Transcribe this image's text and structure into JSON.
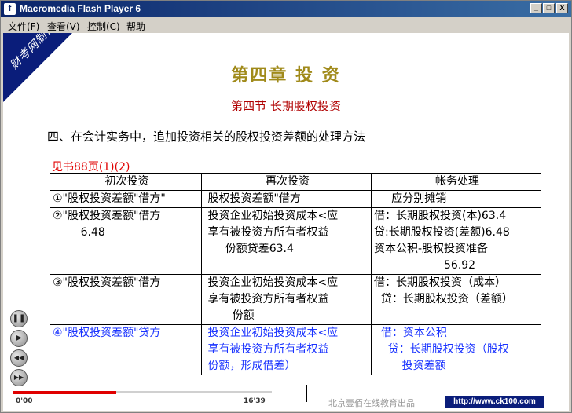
{
  "window": {
    "title": "Macromedia Flash Player 6",
    "app_icon_glyph": "f",
    "minimize": "_",
    "maximize": "□",
    "close": "X"
  },
  "menu": [
    "文件(F)",
    "查看(V)",
    "控制(C)",
    "帮助"
  ],
  "slide": {
    "corner_label": "财考网制作",
    "chapter_title": "第四章 投 资",
    "section_title": "第四节 长期股权投资",
    "heading": "四、在会计实务中，追加投资相关的股权投资差额的处理方法",
    "reference": "见书88页(1)(2)",
    "table": {
      "headers": [
        "初次投资",
        "再次投资",
        "帐务处理"
      ],
      "rows": [
        {
          "c1": [
            "①\"股权投资差额\"借方\""
          ],
          "c2": [
            " 股权投资差额\"借方"
          ],
          "c3": [
            "     应分别摊销"
          ]
        },
        {
          "c1": [
            "②\"股权投资差额\"借方",
            "        6.48"
          ],
          "c2": [
            " 投资企业初始投资成本<应",
            " 享有被投资方所有者权益",
            "      份额贷差63.4"
          ],
          "c3": [
            "借：长期股权投资(本)63.4",
            "贷:长期股权投资(差额)6.48",
            "资本公积-股权投资准备",
            "                    56.92"
          ]
        },
        {
          "c1": [
            "③\"股权投资差额\"借方"
          ],
          "c2": [
            " 投资企业初始投资成本<应",
            " 享有被投资方所有者权益",
            "        份额"
          ],
          "c3": [
            "借：长期股权投资（成本）",
            "  贷：长期股权投资（差额）"
          ]
        },
        {
          "c1": [
            "④\"股权投资差额\"贷方"
          ],
          "c2": [
            " 投资企业初始投资成本<应",
            " 享有被投资方所有者权益",
            " 份额，形成借差）"
          ],
          "c3": [
            "  借：资本公积",
            "    贷：长期股权投资（股权",
            "        投资差额"
          ]
        }
      ]
    }
  },
  "controls": {
    "pause_glyph": "❚❚",
    "play_glyph": "▶",
    "rewind_glyph": "◀◀",
    "forward_glyph": "▶▶"
  },
  "timeline": {
    "current_time": "0'00",
    "total_time": "16'39",
    "progress": 0.4,
    "publisher": "北京壹佰在线教育出品",
    "url": "http://www.ck100.com"
  },
  "colors": {
    "titlebar": "#0a246a",
    "corner": "#0a1d7a",
    "chapter": "#a08a1a",
    "section": "#b00000",
    "reference": "#e00000",
    "row4_text": "#1a33ff",
    "progress": "#e00000"
  }
}
